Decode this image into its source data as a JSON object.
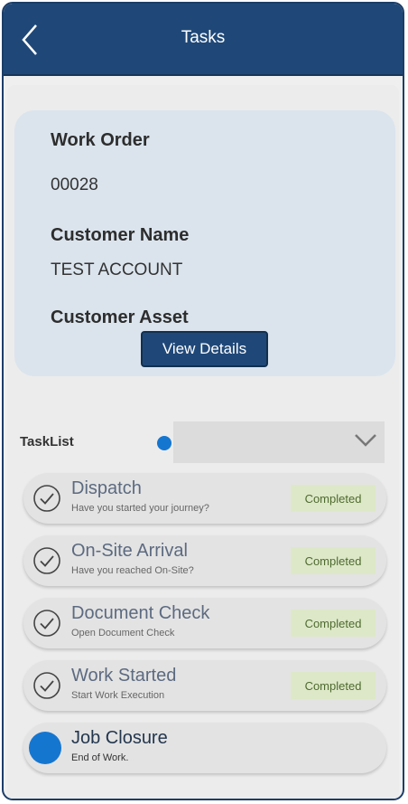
{
  "header": {
    "title": "Tasks"
  },
  "work_order": {
    "order_label": "Work Order",
    "order_number": "00028",
    "customer_label": "Customer Name",
    "customer_name": "TEST ACCOUNT",
    "asset_label": "Customer Asset",
    "view_details_label": "View Details"
  },
  "tasklist": {
    "label": "TaskList"
  },
  "tasks": [
    {
      "title": "Dispatch",
      "subtitle": "Have you started your journey?",
      "status": "Completed"
    },
    {
      "title": "On-Site Arrival",
      "subtitle": "Have you reached On-Site?",
      "status": "Completed"
    },
    {
      "title": "Document Check",
      "subtitle": "Open Document Check",
      "status": "Completed"
    },
    {
      "title": "Work Started",
      "subtitle": "Start Work Execution",
      "status": "Completed"
    },
    {
      "title": "Job Closure",
      "subtitle": "End of Work.",
      "status": ""
    }
  ],
  "colors": {
    "header": "#1f4878",
    "card": "#dbe4ed",
    "accent_dot": "#1576d0",
    "badge_bg": "#dde8c8",
    "badge_text": "#4e6a2e"
  }
}
